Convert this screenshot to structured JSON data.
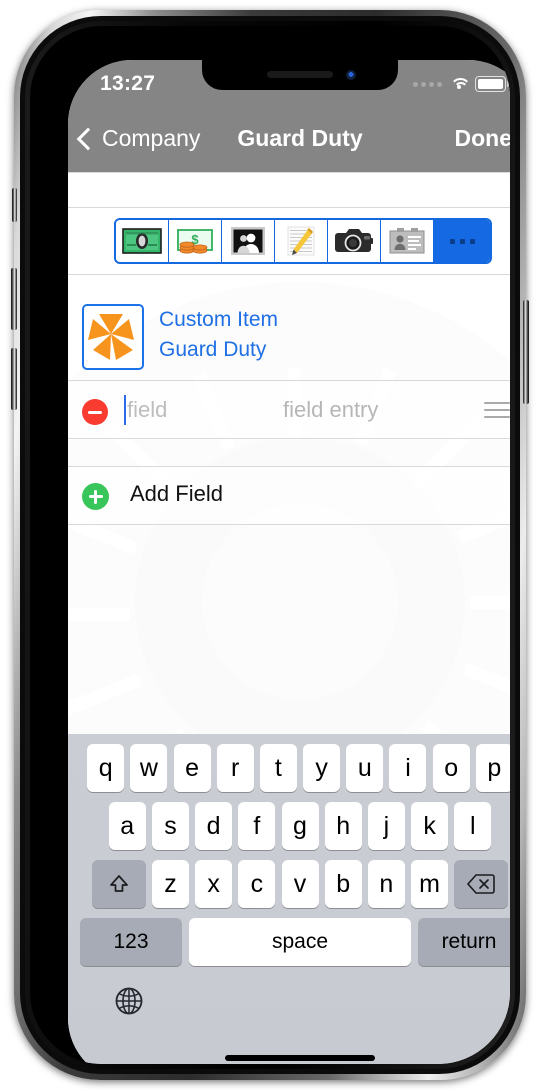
{
  "status_bar": {
    "time": "13:27",
    "cellular_icon": "cellular-dots-icon",
    "wifi_icon": "wifi-icon",
    "battery_icon": "battery-icon"
  },
  "nav_bar": {
    "back_icon": "chevron-left-icon",
    "back_label": "Company",
    "title": "Guard Duty",
    "done_label": "Done"
  },
  "icon_toolbar": {
    "items": [
      {
        "name": "banknote-icon",
        "selected": true
      },
      {
        "name": "money-coins-icon",
        "selected": false
      },
      {
        "name": "person-photo-icon",
        "selected": false
      },
      {
        "name": "notepad-pencil-icon",
        "selected": false
      },
      {
        "name": "camera-icon",
        "selected": false
      },
      {
        "name": "id-card-icon",
        "selected": false
      },
      {
        "name": "more-ellipsis-icon",
        "selected": false
      }
    ],
    "more_label": "..."
  },
  "custom_item": {
    "icon": "orange-pinwheel-icon",
    "type_label": "Custom Item",
    "name_label": "Guard Duty"
  },
  "field_row": {
    "delete_icon": "minus-circle-icon",
    "name_placeholder": "field",
    "entry_placeholder": "field entry",
    "reorder_icon": "reorder-grip-icon"
  },
  "add_field": {
    "icon": "plus-circle-icon",
    "label": "Add Field"
  },
  "keyboard": {
    "row1": [
      "q",
      "w",
      "e",
      "r",
      "t",
      "y",
      "u",
      "i",
      "o",
      "p"
    ],
    "row2": [
      "a",
      "s",
      "d",
      "f",
      "g",
      "h",
      "j",
      "k",
      "l"
    ],
    "row3": [
      "z",
      "x",
      "c",
      "v",
      "b",
      "n",
      "m"
    ],
    "shift_icon": "shift-arrow-icon",
    "backspace_icon": "backspace-icon",
    "numbers_label": "123",
    "space_label": "space",
    "return_label": "return",
    "globe_icon": "globe-icon"
  },
  "colors": {
    "nav_bar": "#858585",
    "accent_blue": "#1f6fe5",
    "toolbar_border": "#1469e0",
    "more_button": "#1569e2",
    "delete_red": "#f93b30",
    "add_green": "#38c65a",
    "pinwheel_orange": "#f7941e",
    "keyboard_bg": "#cbcdd4",
    "key_dark": "#a6abb6"
  }
}
